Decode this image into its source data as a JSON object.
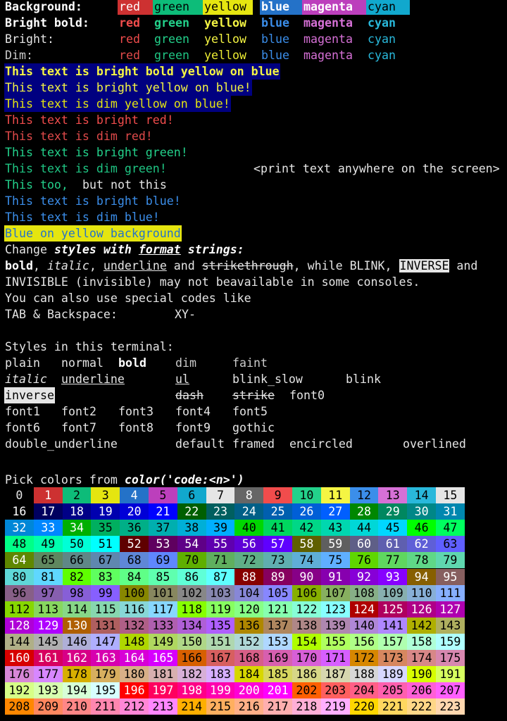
{
  "colors": {
    "background": "#000000",
    "foreground": "#cccccc",
    "bright_white": "#ffffff",
    "red": "#cd3131",
    "green": "#0dbc79",
    "yellow": "#e5e510",
    "blue": "#2472c8",
    "magenta": "#bc3fbc",
    "cyan": "#11a8cd",
    "bright_red": "#f14c4c",
    "bright_green": "#23d18b",
    "bright_yellow": "#f5f543",
    "bright_blue": "#3b8eea",
    "bright_magenta": "#d670d6",
    "bright_cyan": "#29b8db",
    "navy": "#000080",
    "inverse_bg": "#e5e5e5"
  },
  "color_rows": {
    "background_label": "Background:",
    "bright_bold_label": "Bright bold:",
    "bright_label": "Bright:",
    "dim_label": "Dim:",
    "names": [
      "red",
      "green",
      "yellow",
      "blue",
      "magenta",
      "cyan"
    ]
  },
  "lines": {
    "l1": "This text is bright bold yellow on blue",
    "l2": "This text is bright yellow on blue!",
    "l3": "This text is dim yellow on blue!",
    "l4": "This text is bright red!",
    "l5": "This text is dim red!",
    "l6": "This text is bright green!",
    "l7": "This text is dim green!",
    "l7_right": "<print text anywhere on the screen>",
    "l8a": "This too,",
    "l8b": "but not this",
    "l9": "This text is bright blue!",
    "l10": "This text is dim blue!",
    "l11": "Blue on yellow background"
  },
  "format_line": {
    "prefix": "Change ",
    "styles_with": "styles with",
    "space": " ",
    "format": "format",
    "strings": " strings:"
  },
  "styles_line": {
    "bold": "bold",
    "comma1": ", ",
    "italic": "italic",
    "comma2": ", ",
    "underline": "underline",
    "and1": " and ",
    "strikethrough": "strikethrough",
    "while": ", while BLINK, ",
    "inverse": "INVERSE",
    "and2": " and"
  },
  "invisible_line": "INVISIBLE (invisible) may not beavailable in some consoles.",
  "special_codes_line": "You can also use special codes like",
  "tab_line": {
    "text": "TAB & Backspace:",
    "xy": "XY-"
  },
  "terminal_styles": {
    "heading": "Styles in this terminal:",
    "plain": "plain",
    "normal": "normal",
    "bold": "bold",
    "dim": "dim",
    "faint": "faint",
    "italic": "italic",
    "underline": "underline",
    "ul": "ul",
    "blink_slow": "blink_slow",
    "blink": "blink",
    "inverse": "inverse",
    "dash": "dash",
    "strike": "strike",
    "font0": "font0",
    "font1": "font1",
    "font2": "font2",
    "font3": "font3",
    "font4": "font4",
    "font5": "font5",
    "font6": "font6",
    "font7": "font7",
    "font8": "font8",
    "font9": "font9",
    "gothic": "gothic",
    "double_underline": "double_underline",
    "default": "default",
    "framed": "framed",
    "encircled": "encircled",
    "overlined": "overlined"
  },
  "palette_heading": {
    "prefix": "Pick colors from ",
    "code": "color('code:<n>')"
  },
  "palette": {
    "first": 0,
    "last": 223,
    "per_row": 16,
    "standard": [
      "#000000",
      "#cd3131",
      "#0dbc79",
      "#e5e510",
      "#2472c8",
      "#bc3fbc",
      "#11a8cd",
      "#e5e5e5",
      "#666666",
      "#f14c4c",
      "#23d18b",
      "#f5f543",
      "#3b8eea",
      "#d670d6",
      "#29b8db",
      "#e5e5e5"
    ]
  }
}
